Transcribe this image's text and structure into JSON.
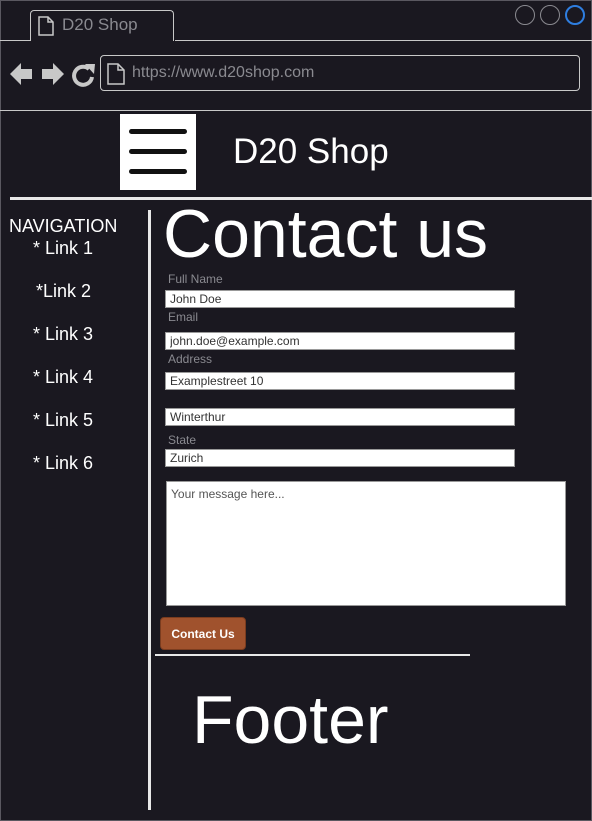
{
  "browser": {
    "tab_title": "D20 Shop",
    "url": "https://www.d20shop.com",
    "accent_color": "#2e7ee0"
  },
  "header": {
    "menu_icon": "hamburger-menu-icon",
    "site_title": "D20 Shop"
  },
  "sidebar": {
    "heading": "NAVIGATION",
    "links": [
      "* Link 1",
      "*Link 2",
      "* Link 3",
      "* Link 4",
      "* Link 5",
      "* Link 6"
    ]
  },
  "main": {
    "title": "Contact us",
    "form": {
      "full_name_label": "Full Name",
      "full_name_value": "John Doe",
      "email_label": "Email",
      "email_value": "john.doe@example.com",
      "address_label": "Address",
      "address_value": "Examplestreet 10",
      "city_value": "Winterthur",
      "state_label": "State",
      "state_value": "Zurich",
      "message_placeholder": "Your message here...",
      "submit_label": "Contact Us",
      "submit_color": "#a0522d"
    }
  },
  "footer": {
    "text": "Footer"
  }
}
